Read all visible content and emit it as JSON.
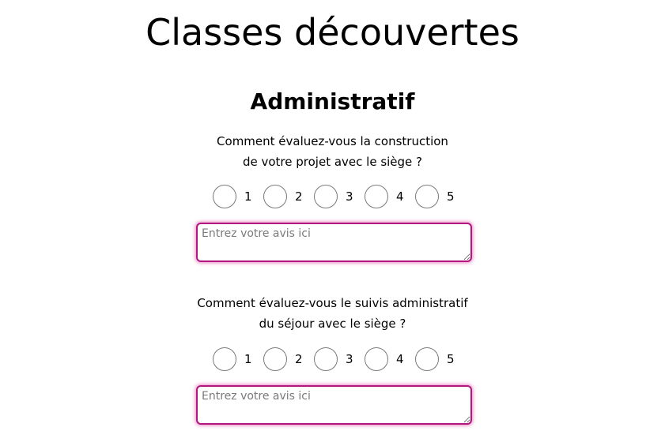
{
  "page": {
    "title": "Classes découvertes"
  },
  "section": {
    "title": "Administratif",
    "questions": [
      {
        "line1": "Comment évaluez-vous la construction",
        "line2": "de votre projet avec le siège ?",
        "options": [
          "1",
          "2",
          "3",
          "4",
          "5"
        ],
        "placeholder": "Entrez votre avis ici"
      },
      {
        "line1": "Comment évaluez-vous le suivis administratif",
        "line2": "du séjour avec le siège ?",
        "options": [
          "1",
          "2",
          "3",
          "4",
          "5"
        ],
        "placeholder": "Entrez votre avis ici"
      }
    ]
  },
  "colors": {
    "textarea_border": "#b0177f",
    "textarea_glow": "#d61f8c",
    "radio_border": "#7a7a7a"
  }
}
